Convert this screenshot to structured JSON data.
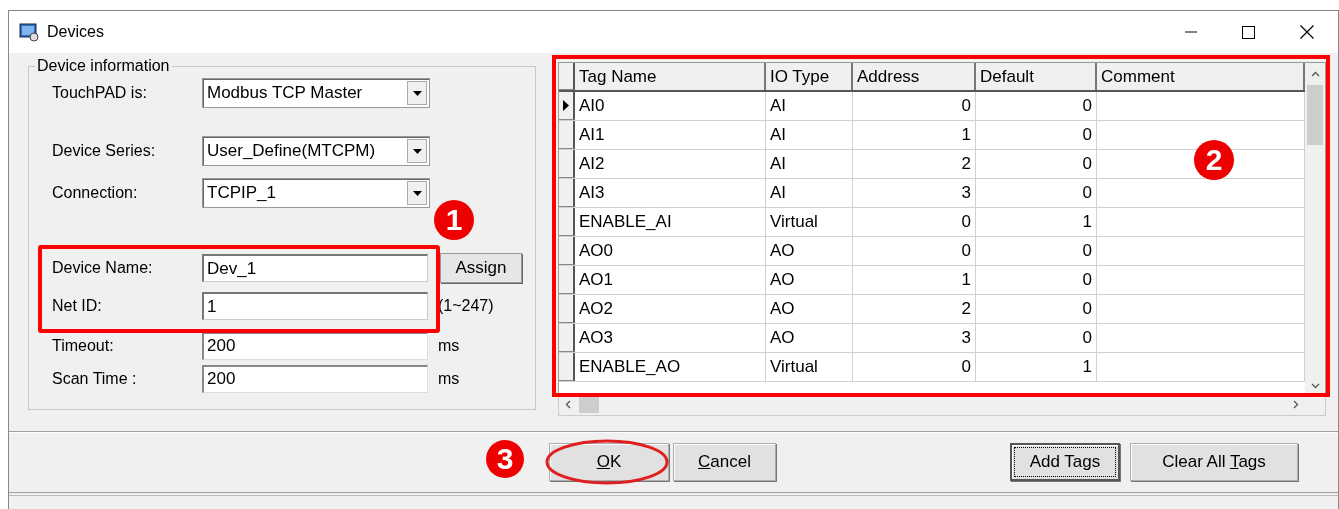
{
  "window": {
    "title": "Devices"
  },
  "device_information": {
    "legend": "Device information",
    "fields": [
      {
        "kind": "combo",
        "label": "TouchPAD is:",
        "value": "Modbus TCP Master"
      },
      {
        "kind": "combo",
        "label": "Device Series:",
        "value": "User_Define(MTCPM)"
      },
      {
        "kind": "combo",
        "label": "Connection:",
        "value": "TCPIP_1"
      },
      {
        "kind": "text",
        "label": "Device Name:",
        "value": "Dev_1",
        "button": "Assign",
        "highlighted": true
      },
      {
        "kind": "text",
        "label": "Net ID:",
        "value": "1",
        "suffix": "(1~247)",
        "highlighted": true
      },
      {
        "kind": "text",
        "label": "Timeout:",
        "value": "200",
        "suffix": "ms",
        "highlighted": false
      },
      {
        "kind": "text",
        "label": "Scan Time :",
        "value": "200",
        "suffix": "ms",
        "highlighted": false
      }
    ]
  },
  "table": {
    "columns": [
      "Tag Name",
      "IO Type",
      "Address",
      "Default",
      "Comment"
    ],
    "rows": [
      {
        "selected": true,
        "cells": [
          "AI0",
          "AI",
          "0",
          "0"
        ]
      },
      {
        "selected": false,
        "cells": [
          "AI1",
          "AI",
          "1",
          "0"
        ]
      },
      {
        "selected": false,
        "cells": [
          "AI2",
          "AI",
          "2",
          "0"
        ]
      },
      {
        "selected": false,
        "cells": [
          "AI3",
          "AI",
          "3",
          "0"
        ]
      },
      {
        "selected": false,
        "cells": [
          "ENABLE_AI",
          "Virtual",
          "0",
          "1"
        ]
      },
      {
        "selected": false,
        "cells": [
          "AO0",
          "AO",
          "0",
          "0"
        ]
      },
      {
        "selected": false,
        "cells": [
          "AO1",
          "AO",
          "1",
          "0"
        ]
      },
      {
        "selected": false,
        "cells": [
          "AO2",
          "AO",
          "2",
          "0"
        ]
      },
      {
        "selected": false,
        "cells": [
          "AO3",
          "AO",
          "3",
          "0"
        ]
      },
      {
        "selected": false,
        "cells": [
          "ENABLE_AO",
          "Virtual",
          "0",
          "1"
        ]
      }
    ]
  },
  "buttons": [
    {
      "label_parts": [
        {
          "text": "O",
          "underlined": true
        },
        {
          "text": "K",
          "underlined": false
        }
      ],
      "focused": false,
      "circled": true
    },
    {
      "label_parts": [
        {
          "text": "C",
          "underlined": true
        },
        {
          "text": "ancel",
          "underlined": false
        }
      ],
      "focused": false,
      "circled": false
    },
    {
      "label_parts": [
        {
          "text": "Add Tags",
          "underlined": false
        }
      ],
      "focused": true,
      "circled": false
    },
    {
      "label_parts": [
        {
          "text": "Clear All ",
          "underlined": false
        },
        {
          "text": "T",
          "underlined": true
        },
        {
          "text": "ags",
          "underlined": false
        }
      ],
      "focused": false,
      "circled": false
    }
  ],
  "annotations": [
    "1",
    "2",
    "3"
  ]
}
